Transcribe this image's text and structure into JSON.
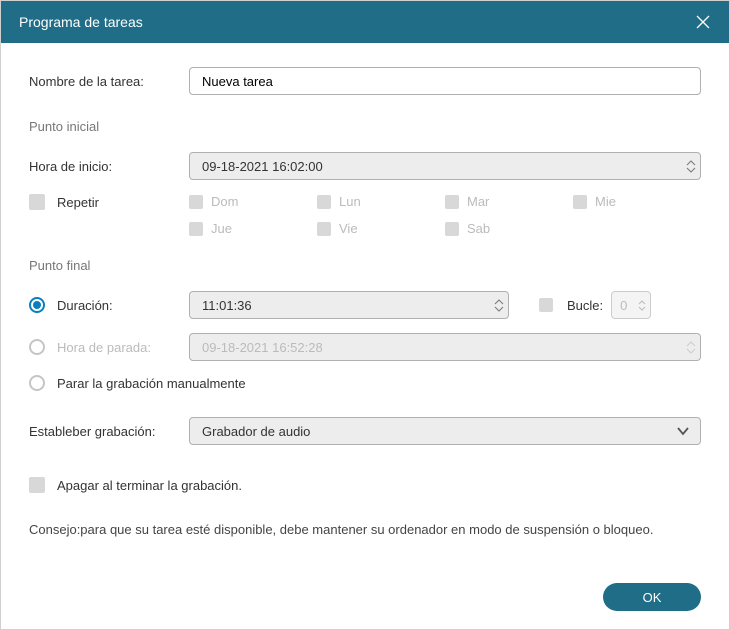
{
  "title": "Programa de tareas",
  "fields": {
    "task_name_label": "Nombre de la tarea:",
    "task_name_value": "Nueva tarea",
    "start_section": "Punto inicial",
    "start_time_label": "Hora de inicio:",
    "start_time_value": "09-18-2021 16:02:00",
    "repeat_label": "Repetir",
    "days": [
      "Dom",
      "Lun",
      "Mar",
      "Mie",
      "Jue",
      "Vie",
      "Sab"
    ],
    "end_section": "Punto final",
    "duration_label": "Duración:",
    "duration_value": "11:01:36",
    "loop_label": "Bucle:",
    "loop_value": "0",
    "stop_time_label": "Hora de parada:",
    "stop_time_value": "09-18-2021 16:52:28",
    "manual_stop_label": "Parar la grabación manualmente",
    "set_recording_label": "Estableber grabación:",
    "set_recording_value": "Grabador de audio",
    "shutdown_label": "Apagar al terminar la grabación.",
    "tip": "Consejo:para que su tarea esté disponible, debe mantener su ordenador en modo de suspensión o bloqueo.",
    "ok": "OK"
  }
}
